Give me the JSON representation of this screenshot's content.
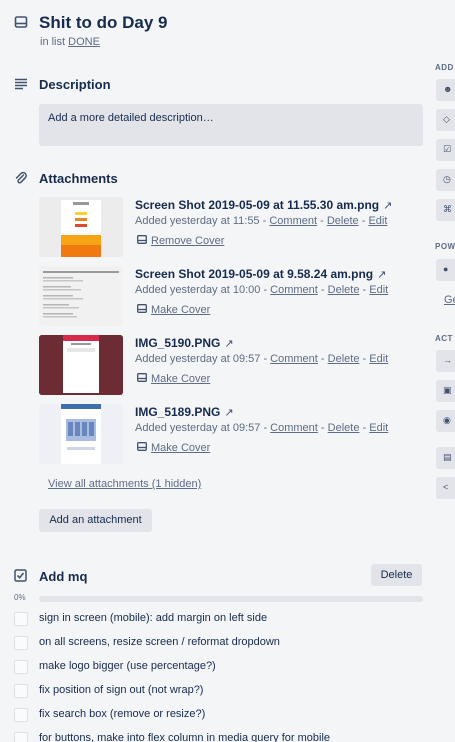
{
  "card": {
    "title": "Shit to do Day 9",
    "in_list_prefix": "in list",
    "list_name": "DONE"
  },
  "description": {
    "heading": "Description",
    "placeholder": "Add a more detailed description…"
  },
  "attachments": {
    "heading": "Attachments",
    "items": [
      {
        "name": "Screen Shot 2019-05-09 at 11.55.30 am.png",
        "added": "Added yesterday at 11:55",
        "cover_action": "Remove Cover"
      },
      {
        "name": "Screen Shot 2019-05-09 at 9.58.24 am.png",
        "added": "Added yesterday at 10:00",
        "cover_action": "Make Cover"
      },
      {
        "name": "IMG_5190.PNG",
        "added": "Added yesterday at 09:57",
        "cover_action": "Make Cover"
      },
      {
        "name": "IMG_5189.PNG",
        "added": "Added yesterday at 09:57",
        "cover_action": "Make Cover"
      }
    ],
    "action_comment": "Comment",
    "action_delete": "Delete",
    "action_edit": "Edit",
    "separator": "-",
    "view_all": "View all attachments (1 hidden)",
    "add_button": "Add an attachment"
  },
  "checklist": {
    "title": "Add mq",
    "delete_button": "Delete",
    "progress_label": "0%",
    "progress": 0,
    "items": [
      "sign in screen (mobile): add margin on left side",
      "on all screens, resize screen / reformat dropdown",
      "make logo bigger (use percentage?)",
      "fix position of sign out (not wrap?)",
      "fix search box (remove or resize?)",
      "for buttons, make into flex column in media query for mobile"
    ]
  },
  "sidebar": {
    "heading_add": "ADD",
    "heading_power": "POW",
    "power_link": "Ge",
    "heading_actions": "ACT"
  },
  "colors": {
    "text": "#172b4d",
    "muted": "#5e6c84",
    "button_bg": "#e2e4e9",
    "page_bg": "#f4f5f7"
  }
}
